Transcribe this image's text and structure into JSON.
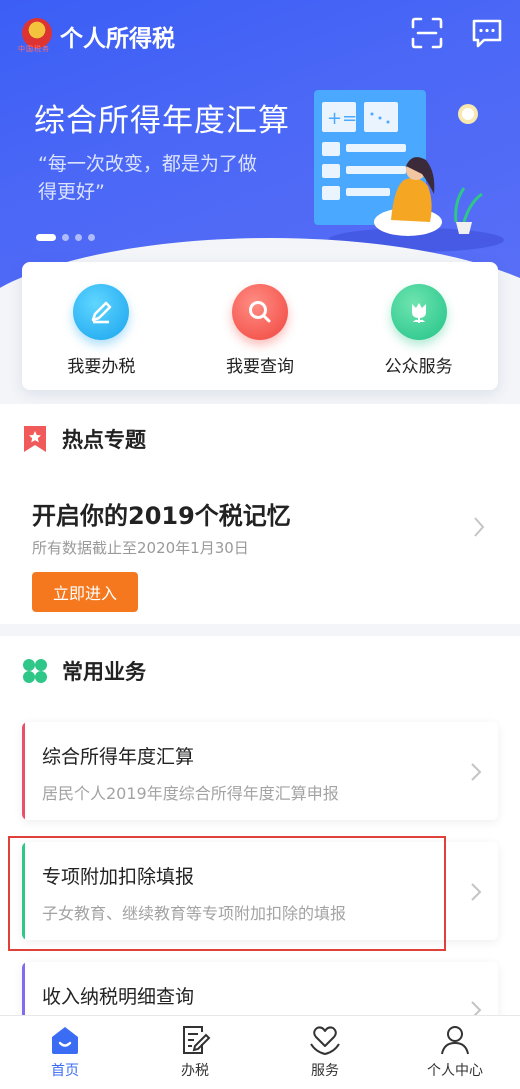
{
  "header": {
    "app_title": "个人所得税",
    "emblem_text": "中国税务"
  },
  "banner": {
    "title": "综合所得年度汇算",
    "subtitle": "“每一次改变，都是为了做得更好”",
    "slide_count": 4,
    "active_slide": 1
  },
  "quick_actions": [
    {
      "label": "我要办税",
      "icon": "pencil-icon"
    },
    {
      "label": "我要查询",
      "icon": "search-icon"
    },
    {
      "label": "公众服务",
      "icon": "tulip-icon"
    }
  ],
  "hot_topics": {
    "section_title": "热点专题",
    "title": "开启你的2019个税记忆",
    "subtitle": "所有数据截止至2020年1月30日",
    "button_label": "立即进入"
  },
  "common_business": {
    "section_title": "常用业务",
    "items": [
      {
        "title": "综合所得年度汇算",
        "subtitle": "居民个人2019年度综合所得年度汇算申报",
        "bar_color": "#e8506a"
      },
      {
        "title": "专项附加扣除填报",
        "subtitle": "子女教育、继续教育等专项附加扣除的填报",
        "bar_color": "#2ec788"
      },
      {
        "title": "收入纳税明细查询",
        "subtitle": "",
        "bar_color": "#7f6cf0"
      }
    ]
  },
  "bottom_nav": [
    {
      "label": "首页",
      "icon": "home-icon",
      "active": true
    },
    {
      "label": "办税",
      "icon": "document-edit-icon",
      "active": false
    },
    {
      "label": "服务",
      "icon": "heart-hands-icon",
      "active": false
    },
    {
      "label": "个人中心",
      "icon": "person-icon",
      "active": false
    }
  ],
  "colors": {
    "brand_blue": "#3b5ef5",
    "accent_orange": "#f5781e",
    "highlight_red": "#e0403a"
  }
}
